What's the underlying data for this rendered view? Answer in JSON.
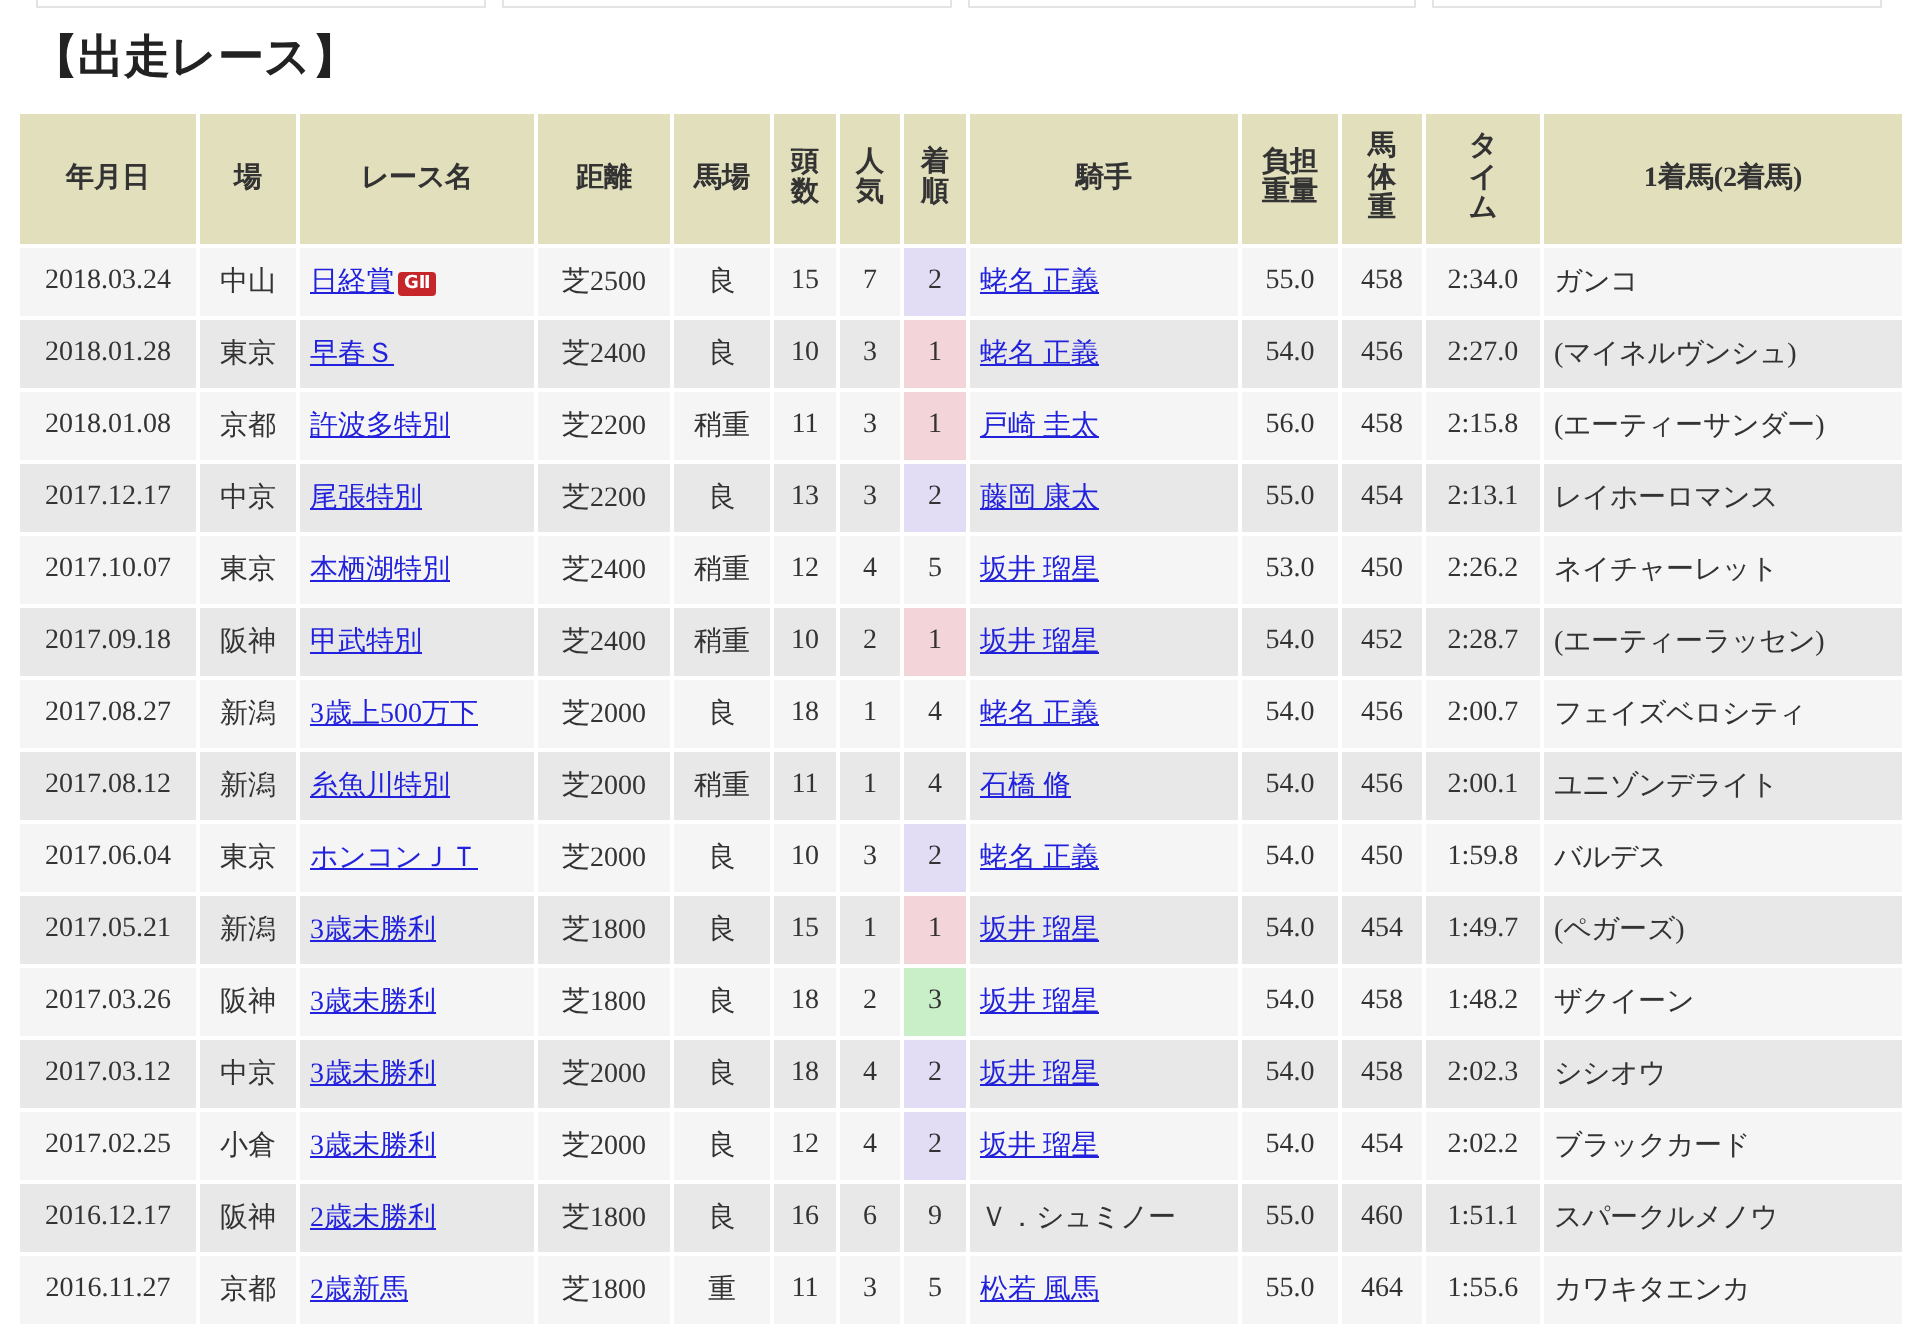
{
  "title": "【出走レース】",
  "table": {
    "columns": [
      {
        "label": "年月日",
        "vertical": false
      },
      {
        "label": "場",
        "vertical": false
      },
      {
        "label": "レース名",
        "vertical": false
      },
      {
        "label": "距離",
        "vertical": false
      },
      {
        "label": "馬場",
        "vertical": false
      },
      {
        "label": "頭数",
        "vertical": true
      },
      {
        "label": "人気",
        "vertical": true
      },
      {
        "label": "着順",
        "vertical": true
      },
      {
        "label": "騎手",
        "vertical": false
      },
      {
        "label": "負担重量",
        "vertical": false
      },
      {
        "label": "馬体重",
        "vertical": true
      },
      {
        "label": "タイム",
        "vertical": true
      },
      {
        "label": "1着馬(2着馬)",
        "vertical": false
      }
    ],
    "rows": [
      {
        "date": "2018.03.24",
        "venue": "中山",
        "race": "日経賞",
        "grade": "GⅡ",
        "distance": "芝2500",
        "going": "良",
        "runners": "15",
        "popularity": "7",
        "finish": "2",
        "color": "#e2dcf5",
        "jockey": "蛯名 正義",
        "jockey_link": true,
        "weight": "55.0",
        "horse_weight": "458",
        "time": "2:34.0",
        "winner": "ガンコ"
      },
      {
        "date": "2018.01.28",
        "venue": "東京",
        "race": "早春Ｓ",
        "distance": "芝2400",
        "going": "良",
        "runners": "10",
        "popularity": "3",
        "finish": "1",
        "color": "#f3d5d9",
        "jockey": "蛯名 正義",
        "jockey_link": true,
        "weight": "54.0",
        "horse_weight": "456",
        "time": "2:27.0",
        "winner": "(マイネルヴンシュ)"
      },
      {
        "date": "2018.01.08",
        "venue": "京都",
        "race": "許波多特別",
        "distance": "芝2200",
        "going": "稍重",
        "runners": "11",
        "popularity": "3",
        "finish": "1",
        "color": "#f3d5d9",
        "jockey": "戸崎 圭太",
        "jockey_link": true,
        "weight": "56.0",
        "horse_weight": "458",
        "time": "2:15.8",
        "winner": "(エーティーサンダー)"
      },
      {
        "date": "2017.12.17",
        "venue": "中京",
        "race": "尾張特別",
        "distance": "芝2200",
        "going": "良",
        "runners": "13",
        "popularity": "3",
        "finish": "2",
        "color": "#e2dcf5",
        "jockey": "藤岡 康太",
        "jockey_link": true,
        "weight": "55.0",
        "horse_weight": "454",
        "time": "2:13.1",
        "winner": "レイホーロマンス"
      },
      {
        "date": "2017.10.07",
        "venue": "東京",
        "race": "本栖湖特別",
        "distance": "芝2400",
        "going": "稍重",
        "runners": "12",
        "popularity": "4",
        "finish": "5",
        "jockey": "坂井 瑠星",
        "jockey_link": true,
        "weight": "53.0",
        "horse_weight": "450",
        "time": "2:26.2",
        "winner": "ネイチャーレット"
      },
      {
        "date": "2017.09.18",
        "venue": "阪神",
        "race": "甲武特別",
        "distance": "芝2400",
        "going": "稍重",
        "runners": "10",
        "popularity": "2",
        "finish": "1",
        "color": "#f3d5d9",
        "jockey": "坂井 瑠星",
        "jockey_link": true,
        "weight": "54.0",
        "horse_weight": "452",
        "time": "2:28.7",
        "winner": "(エーティーラッセン)"
      },
      {
        "date": "2017.08.27",
        "venue": "新潟",
        "race": "3歳上500万下",
        "distance": "芝2000",
        "going": "良",
        "runners": "18",
        "popularity": "1",
        "finish": "4",
        "jockey": "蛯名 正義",
        "jockey_link": true,
        "weight": "54.0",
        "horse_weight": "456",
        "time": "2:00.7",
        "winner": "フェイズベロシティ"
      },
      {
        "date": "2017.08.12",
        "venue": "新潟",
        "race": "糸魚川特別",
        "distance": "芝2000",
        "going": "稍重",
        "runners": "11",
        "popularity": "1",
        "finish": "4",
        "jockey": "石橋 脩",
        "jockey_link": true,
        "weight": "54.0",
        "horse_weight": "456",
        "time": "2:00.1",
        "winner": "ユニゾンデライト"
      },
      {
        "date": "2017.06.04",
        "venue": "東京",
        "race": "ホンコンＪＴ",
        "distance": "芝2000",
        "going": "良",
        "runners": "10",
        "popularity": "3",
        "finish": "2",
        "color": "#e2dcf5",
        "jockey": "蛯名 正義",
        "jockey_link": true,
        "weight": "54.0",
        "horse_weight": "450",
        "time": "1:59.8",
        "winner": "バルデス"
      },
      {
        "date": "2017.05.21",
        "venue": "新潟",
        "race": "3歳未勝利",
        "distance": "芝1800",
        "going": "良",
        "runners": "15",
        "popularity": "1",
        "finish": "1",
        "color": "#f3d5d9",
        "jockey": "坂井 瑠星",
        "jockey_link": true,
        "weight": "54.0",
        "horse_weight": "454",
        "time": "1:49.7",
        "winner": "(ペガーズ)"
      },
      {
        "date": "2017.03.26",
        "venue": "阪神",
        "race": "3歳未勝利",
        "distance": "芝1800",
        "going": "良",
        "runners": "18",
        "popularity": "2",
        "finish": "3",
        "color": "#c9efc9",
        "jockey": "坂井 瑠星",
        "jockey_link": true,
        "weight": "54.0",
        "horse_weight": "458",
        "time": "1:48.2",
        "winner": "ザクイーン"
      },
      {
        "date": "2017.03.12",
        "venue": "中京",
        "race": "3歳未勝利",
        "distance": "芝2000",
        "going": "良",
        "runners": "18",
        "popularity": "4",
        "finish": "2",
        "color": "#e2dcf5",
        "jockey": "坂井 瑠星",
        "jockey_link": true,
        "weight": "54.0",
        "horse_weight": "458",
        "time": "2:02.3",
        "winner": "シシオウ"
      },
      {
        "date": "2017.02.25",
        "venue": "小倉",
        "race": "3歳未勝利",
        "distance": "芝2000",
        "going": "良",
        "runners": "12",
        "popularity": "4",
        "finish": "2",
        "color": "#e2dcf5",
        "jockey": "坂井 瑠星",
        "jockey_link": true,
        "weight": "54.0",
        "horse_weight": "454",
        "time": "2:02.2",
        "winner": "ブラックカード"
      },
      {
        "date": "2016.12.17",
        "venue": "阪神",
        "race": "2歳未勝利",
        "distance": "芝1800",
        "going": "良",
        "runners": "16",
        "popularity": "6",
        "finish": "9",
        "jockey": "Ｖ．シュミノー",
        "jockey_link": false,
        "weight": "55.0",
        "horse_weight": "460",
        "time": "1:51.1",
        "winner": "スパークルメノウ"
      },
      {
        "date": "2016.11.27",
        "venue": "京都",
        "race": "2歳新馬",
        "distance": "芝1800",
        "going": "重",
        "runners": "11",
        "popularity": "3",
        "finish": "5",
        "jockey": "松若 風馬",
        "jockey_link": true,
        "weight": "55.0",
        "horse_weight": "464",
        "time": "1:55.6",
        "winner": "カワキタエンカ"
      }
    ]
  }
}
